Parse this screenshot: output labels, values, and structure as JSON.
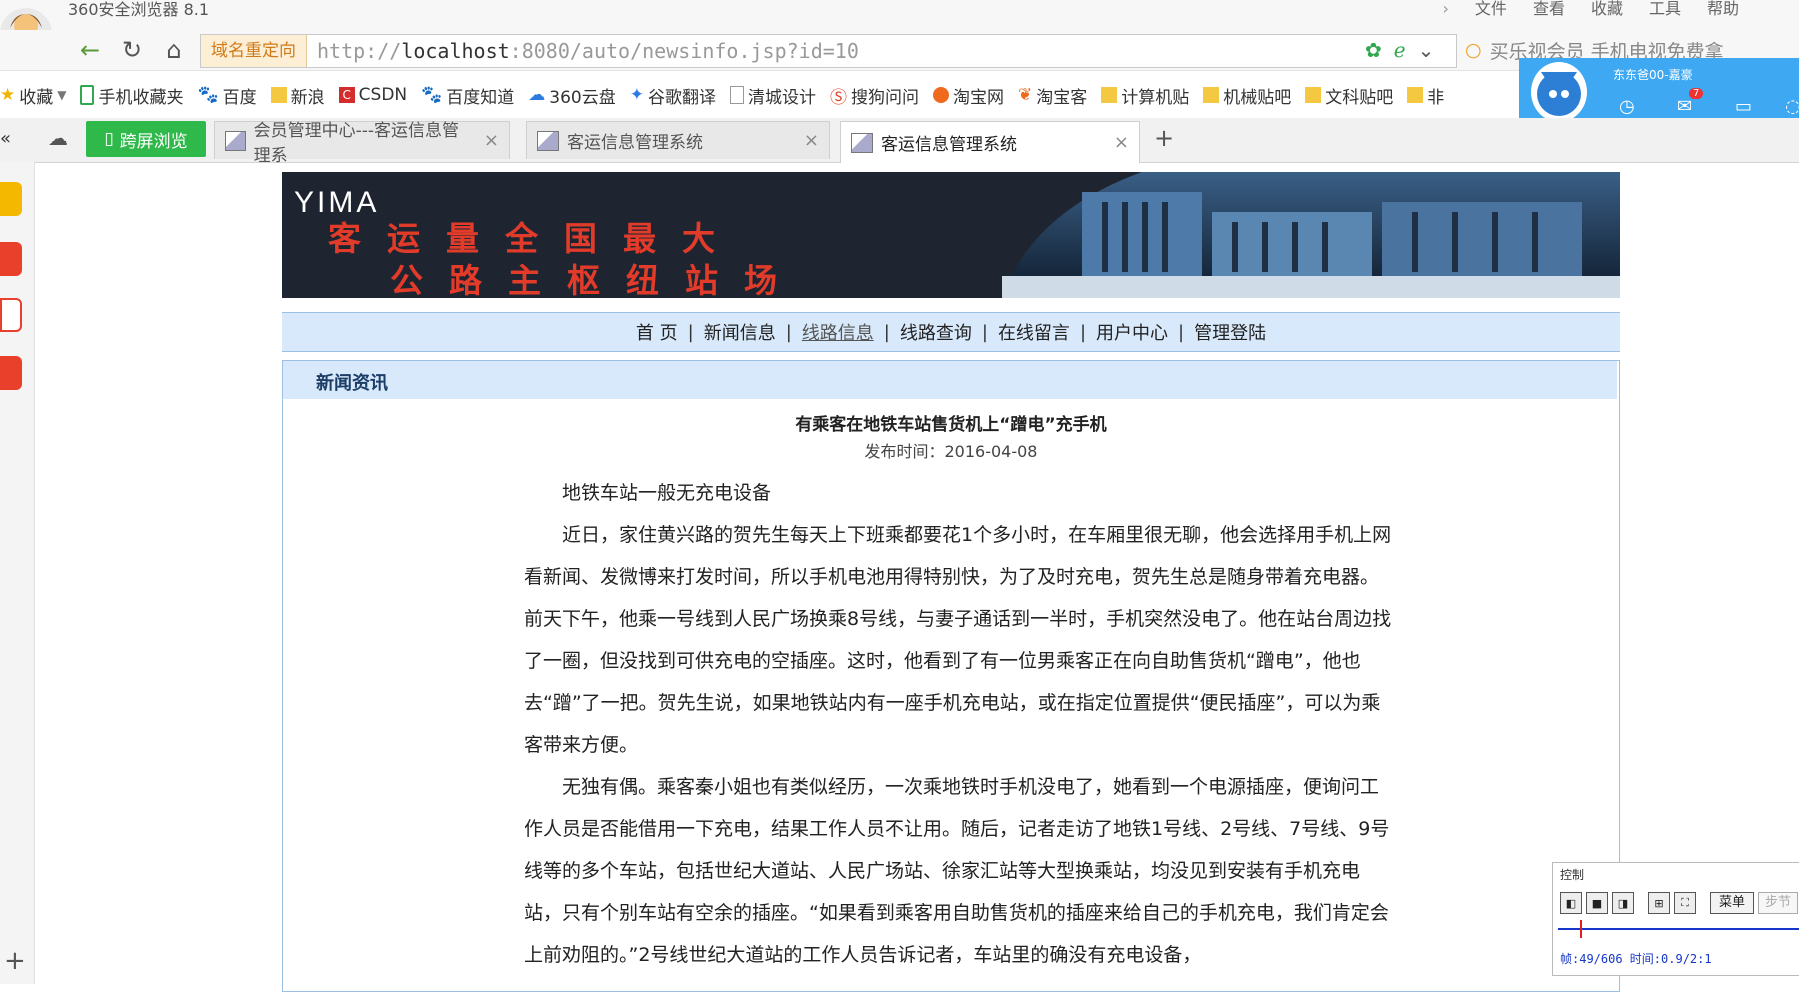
{
  "app": {
    "title": "360安全浏览器 8.1",
    "menu": [
      "文件",
      "查看",
      "收藏",
      "工具",
      "帮助"
    ]
  },
  "address": {
    "redirect_label": "域名重定向",
    "url_prefix": "http://",
    "url_host": "localhost",
    "url_rest": ":8080/auto/newsinfo.jsp?id=10",
    "search_text": "买乐视会员 手机电视免费拿"
  },
  "bookmarks": [
    "收藏",
    "手机收藏夹",
    "百度",
    "新浪",
    "CSDN",
    "百度知道",
    "360云盘",
    "谷歌翻译",
    "清城设计",
    "搜狗问问",
    "淘宝网",
    "淘宝客",
    "计算机贴",
    "机械贴吧",
    "文科贴吧",
    "非"
  ],
  "tabs": {
    "kuaping": "跨屏浏览",
    "items": [
      {
        "label": "会员管理中心---客运信息管理系"
      },
      {
        "label": "客运信息管理系统"
      },
      {
        "label": "客运信息管理系统"
      }
    ]
  },
  "popup": {
    "user": "东东爸00-嘉豪",
    "mail_count": "7"
  },
  "site": {
    "logo": "YIMA",
    "slogan1": "客运量全国最大",
    "slogan2": "公路主枢纽站场",
    "nav": [
      "首 页",
      "新闻信息",
      "线路信息",
      "线路查询",
      "在线留言",
      "用户中心",
      "管理登陆"
    ],
    "section_title": "新闻资讯"
  },
  "article": {
    "title": "有乘客在地铁车站售货机上“蹭电”充手机",
    "date": "发布时间：2016-04-08",
    "paragraphs": [
      "地铁车站一般无充电设备",
      "近日，家住黄兴路的贺先生每天上下班乘都要花1个多小时，在车厢里很无聊，他会选择用手机上网看新闻、发微博来打发时间，所以手机电池用得特别快，为了及时充电，贺先生总是随身带着充电器。前天下午，他乘一号线到人民广场换乘8号线，与妻子通话到一半时，手机突然没电了。他在站台周边找了一圈，但没找到可供充电的空插座。这时，他看到了有一位男乘客正在向自助售货机“蹭电”，他也去“蹭”了一把。贺先生说，如果地铁站内有一座手机充电站，或在指定位置提供“便民插座”，可以为乘客带来方便。",
      "无独有偶。乘客秦小姐也有类似经历，一次乘地铁时手机没电了，她看到一个电源插座，便询问工作人员是否能借用一下充电，结果工作人员不让用。随后，记者走访了地铁1号线、2号线、7号线、9号线等的多个车站，包括世纪大道站、人民广场站、徐家汇站等大型换乘站，均没见到安装有手机充电站，只有个别车站有空余的插座。“如果看到乘客用自助售货机的插座来给自己的手机充电，我们肯定会上前劝阻的。”2号线世纪大道站的工作人员告诉记者，车站里的确没有充电设备，"
    ]
  },
  "control": {
    "label": "控制",
    "menu": "菜单",
    "step": "步节",
    "frame": "帧:49/606 时间:0.9/2:1"
  }
}
